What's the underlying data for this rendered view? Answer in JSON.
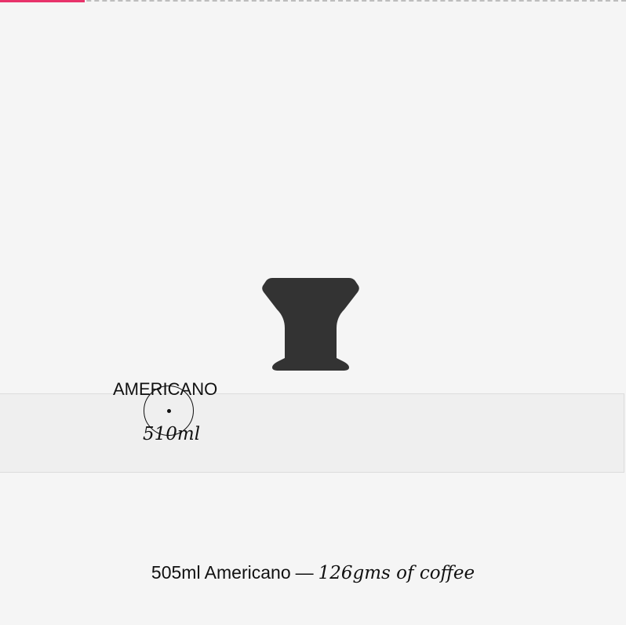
{
  "progress": {
    "value_percent": 13.5,
    "fill_color": "#e8336b",
    "track_color": "#bdbdbd"
  },
  "cup": {
    "icon": "espresso-cup-icon",
    "color": "#333333"
  },
  "slider": {
    "size_label": "AMERICANO",
    "volume_label": "510ml"
  },
  "summary": {
    "drink_text": "505ml Americano",
    "separator": "—",
    "coffee_text": "126gms of coffee"
  }
}
